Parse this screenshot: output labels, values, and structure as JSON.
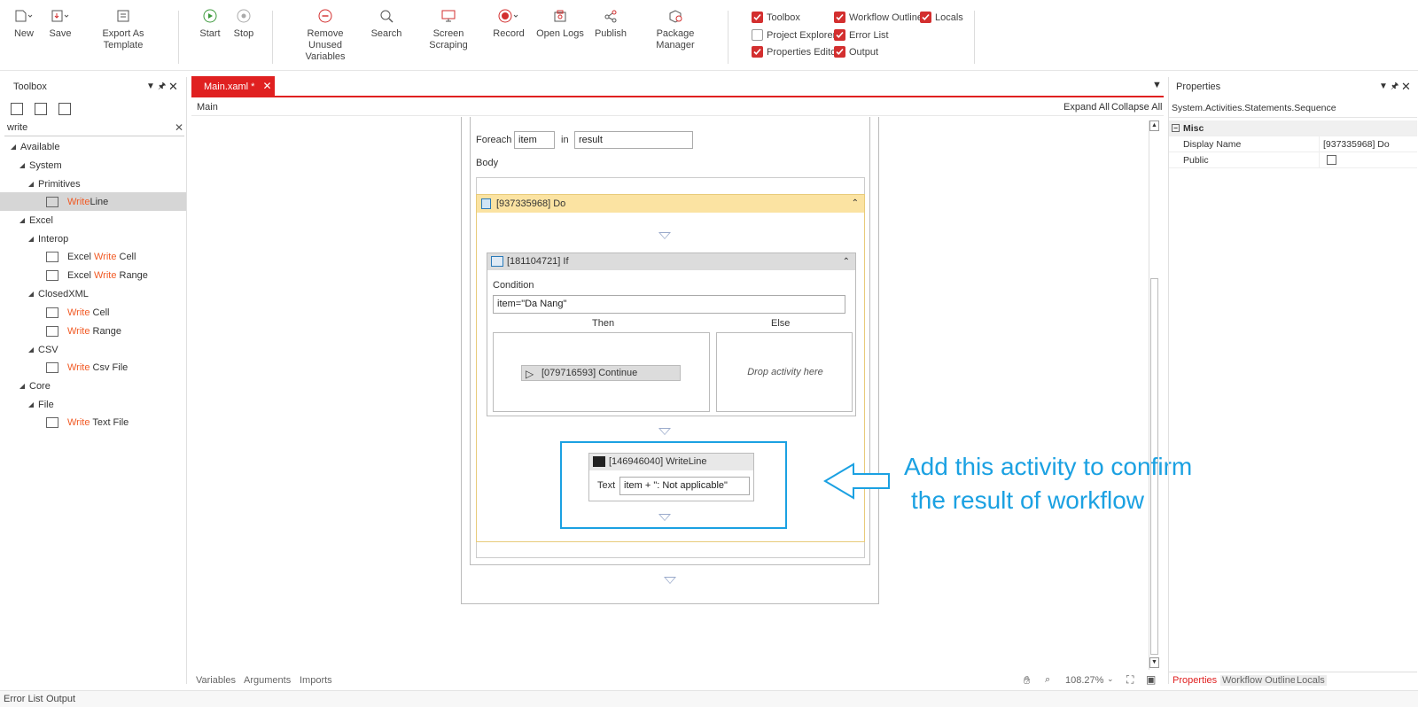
{
  "ribbon": {
    "new": "New",
    "save": "Save",
    "export_template": "Export As Template",
    "start": "Start",
    "stop": "Stop",
    "remove_unused_line1": "Remove Unused",
    "remove_unused_line2": "Variables",
    "search": "Search",
    "screen_scraping": "Screen Scraping",
    "record": "Record",
    "open_logs": "Open Logs",
    "publish": "Publish",
    "package_manager": "Package Manager",
    "checks": {
      "toolbox": "Toolbox",
      "workflow_outline": "Workflow Outline",
      "locals": "Locals",
      "project_explorer": "Project Explorer",
      "error_list": "Error List",
      "properties_editor": "Properties Editor",
      "output": "Output"
    }
  },
  "toolbox": {
    "title": "Toolbox",
    "search_value": "write",
    "tree": {
      "available": "Available",
      "system": "System",
      "primitives": "Primitives",
      "writeline_hl": "Write",
      "writeline_rest": "Line",
      "excel": "Excel",
      "interop": "Interop",
      "excel_write_cell_pre": "Excel ",
      "excel_write_cell_hl": "Write",
      "excel_write_cell_post": " Cell",
      "excel_write_range_pre": "Excel ",
      "excel_write_range_hl": "Write",
      "excel_write_range_post": " Range",
      "closedxml": "ClosedXML",
      "write_cell_hl": "Write",
      "write_cell_post": " Cell",
      "write_range_hl": "Write",
      "write_range_post": " Range",
      "csv": "CSV",
      "write_csv_hl": "Write",
      "write_csv_post": " Csv File",
      "core": "Core",
      "file": "File",
      "write_text_hl": "Write",
      "write_text_post": " Text File"
    }
  },
  "designer": {
    "tab_label": "Main.xaml *",
    "breadcrumb": "Main",
    "expand_all": "Expand All",
    "collapse_all": "Collapse All",
    "foreach_label": "Foreach",
    "foreach_item": "item",
    "in_label": "in",
    "foreach_source": "result",
    "body_label": "Body",
    "sequence_title": "[937335968] Do",
    "if_title": "[181104721] If",
    "condition_label": "Condition",
    "condition_value": "item=\"Da Nang\"",
    "then_label": "Then",
    "else_label": "Else",
    "continue_title": "[079716593] Continue",
    "drop_hint": "Drop activity here",
    "writeline_title": "[146946040] WriteLine",
    "text_label": "Text",
    "text_value": "item + \": Not applicable\"",
    "annotation_line1": "Add this activity to confirm",
    "annotation_line2": "the result of workflow",
    "bottom_tabs": [
      "Variables",
      "Arguments",
      "Imports"
    ],
    "zoom": "108.27%"
  },
  "properties": {
    "title": "Properties",
    "type_name": "System.Activities.Statements.Sequence",
    "category": "Misc",
    "display_name_label": "Display Name",
    "display_name_value": "[937335968] Do",
    "public_label": "Public",
    "bottom_tabs": [
      "Properties",
      "Workflow Outline",
      "Locals"
    ]
  },
  "status": {
    "error_list": "Error List",
    "output": "Output"
  },
  "colors": {
    "accent": "#e02020",
    "highlight": "#f15a24",
    "annotation": "#1ba1e2",
    "sequence_header": "#fbe3a2"
  }
}
